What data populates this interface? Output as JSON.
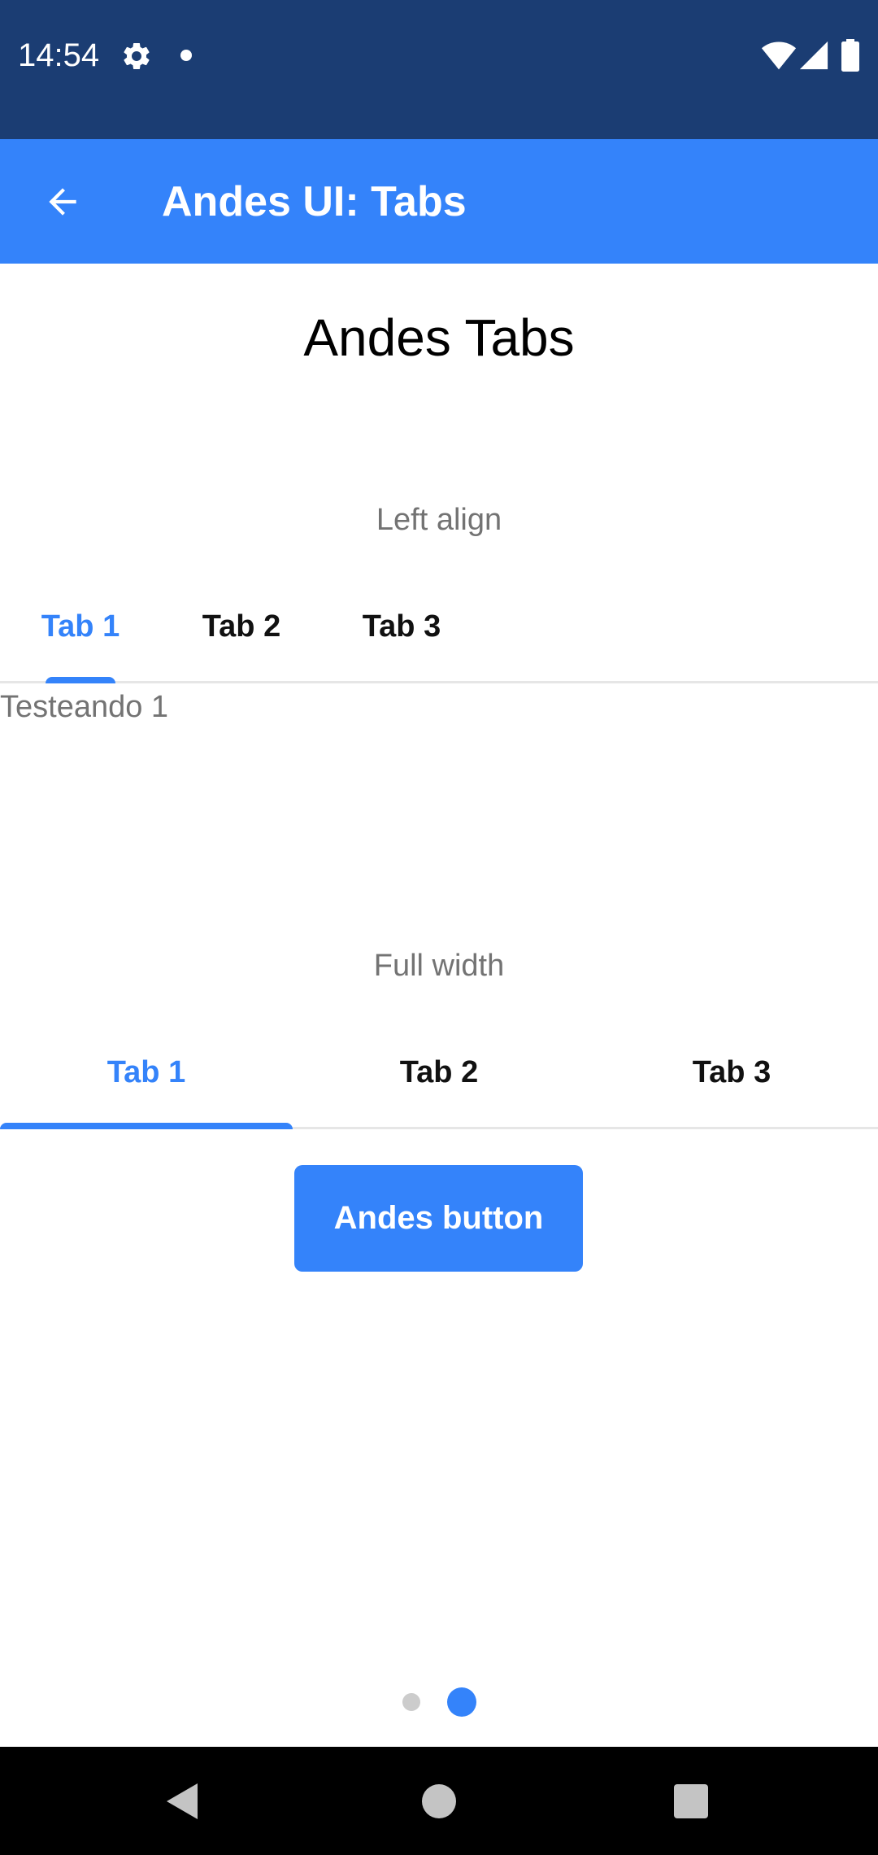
{
  "status_bar": {
    "time": "14:54",
    "icons": [
      "gear-icon",
      "notification-dot-icon",
      "wifi-icon",
      "cellular-signal-icon",
      "battery-icon"
    ]
  },
  "app_bar": {
    "title": "Andes UI: Tabs",
    "back_icon": "arrow-back-icon"
  },
  "main": {
    "heading": "Andes Tabs",
    "sections": [
      {
        "caption": "Left align",
        "tabs": [
          "Tab 1",
          "Tab 2",
          "Tab 3"
        ],
        "selected": 0,
        "content": "Testeando 1"
      },
      {
        "caption": "Full width",
        "tabs": [
          "Tab 1",
          "Tab 2",
          "Tab 3"
        ],
        "selected": 0
      }
    ],
    "button_label": "Andes button"
  },
  "pager": {
    "count": 2,
    "active_index": 1
  },
  "nav_bar": {
    "icons": [
      "back-triangle-icon",
      "home-circle-icon",
      "recents-square-icon"
    ]
  },
  "colors": {
    "status_bar": "#1b3d73",
    "accent": "#3483fa",
    "caption_gray": "#737373",
    "divider": "#e6e6e6",
    "pager_inactive": "#cccccc"
  }
}
